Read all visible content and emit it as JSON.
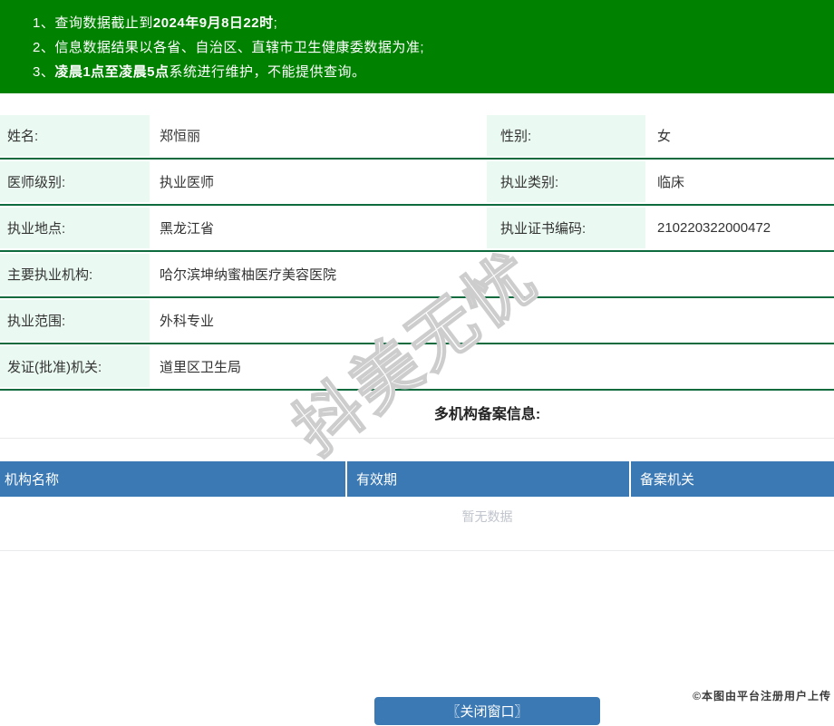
{
  "colors": {
    "banner_green": "#008100",
    "row_rule_green": "#0e6b3e",
    "label_mint": "#eafaf2",
    "header_blue": "#3b79b5",
    "empty_gray": "#c0c4cc"
  },
  "notice": {
    "lines": [
      {
        "num": "1、",
        "a": "查询数据截止到",
        "b": "2024年9月8日22时",
        "c": ";"
      },
      {
        "num": "2、",
        "a": "信息数据结果以各省、自治区、直辖市卫生健康委数据为准;",
        "b": "",
        "c": ""
      },
      {
        "num": "3、",
        "a": "",
        "b": "凌晨1点至凌晨5点",
        "c": "系统进行维护，不能提供查询。"
      }
    ]
  },
  "info": {
    "rows": [
      {
        "label": "姓名:",
        "value": "郑恒丽",
        "label2": "性别:",
        "value2": "女"
      },
      {
        "label": "医师级别:",
        "value": "执业医师",
        "label2": "执业类别:",
        "value2": "临床"
      },
      {
        "label": "执业地点:",
        "value": "黑龙江省",
        "label2": "执业证书编码:",
        "value2": "210220322000472"
      },
      {
        "label": "主要执业机构:",
        "value": "哈尔滨坤纳蜜柚医疗美容医院"
      },
      {
        "label": "执业范围:",
        "value": "外科专业"
      },
      {
        "label": "发证(批准)机关:",
        "value": "道里区卫生局"
      }
    ]
  },
  "filing": {
    "title": "多机构备案信息:",
    "headers": [
      "机构名称",
      "有效期",
      "备案机关"
    ],
    "empty_text": "暂无数据"
  },
  "footer": {
    "close_label": "〖关闭窗口〗",
    "credit": "©本图由平台注册用户上传"
  },
  "watermark": {
    "text": "抖美无忧"
  }
}
